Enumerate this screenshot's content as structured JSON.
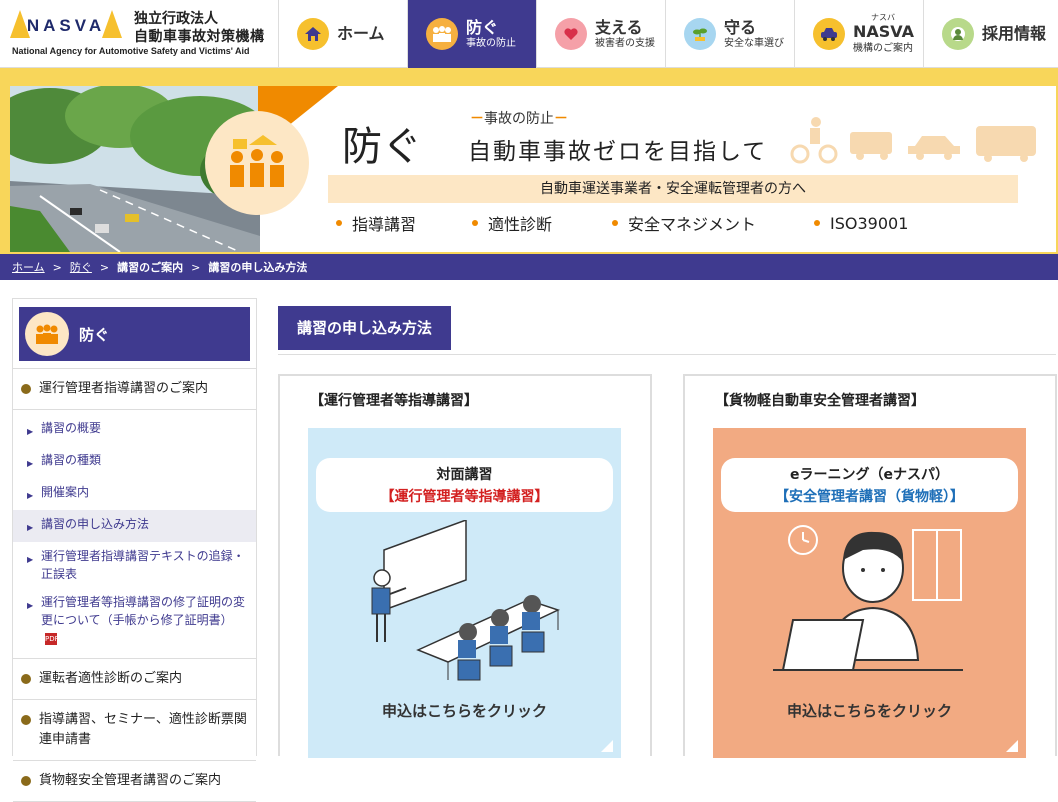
{
  "header": {
    "logo_mark": "NASVA",
    "org_line1": "独立行政法人",
    "org_line2": "自動車事故対策機構",
    "org_en": "National Agency for Automotive Safety and Victims' Aid"
  },
  "gnav": [
    {
      "main": "ホーム",
      "sub": "",
      "icon": "home-icon",
      "color": "#f6c02e"
    },
    {
      "main": "防ぐ",
      "sub": "事故の防止",
      "icon": "people-icon",
      "color": "#f6b040",
      "active": true
    },
    {
      "main": "支える",
      "sub": "被害者の支援",
      "icon": "heart-hand-icon",
      "color": "#f5a0a8"
    },
    {
      "main": "守る",
      "sub": "安全な車選び",
      "icon": "sprout-icon",
      "color": "#a7d6f0"
    },
    {
      "main": "NASVA",
      "ruby": "ナスバ",
      "sub": "機構のご案内",
      "icon": "car-icon",
      "color": "#f6c02e"
    },
    {
      "main": "採用情報",
      "sub": "",
      "icon": "person-icon",
      "color": "#b8d98a"
    }
  ],
  "banner": {
    "title": "防ぐ",
    "kicker": "事故の防止",
    "headline": "自動車事故ゼロを目指して",
    "bar_text": "自動車運送事業者・安全運転管理者の方へ",
    "links": [
      "指導講習",
      "適性診断",
      "安全マネジメント",
      "ISO39001"
    ]
  },
  "breadcrumb": {
    "home": "ホーム",
    "sep": ">",
    "prevent": "防ぐ",
    "courses": "講習のご案内",
    "current": "講習の申し込み方法"
  },
  "sidebar": {
    "head_label": "防ぐ",
    "section1": "運行管理者指導講習のご案内",
    "subs": [
      "講習の概要",
      "講習の種類",
      "開催案内",
      "講習の申し込み方法",
      "運行管理者指導講習テキストの追録・正誤表",
      "運行管理者等指導講習の修了証明の変更について（手帳から修了証明書）"
    ],
    "section2": "運転者適性診断のご案内",
    "section3": "指導講習、セミナー、適性診断票関連申請書",
    "section4": "貨物軽安全管理者講習のご案内",
    "pdf_label": "PDF"
  },
  "main": {
    "page_title": "講習の申し込み方法",
    "cards": [
      {
        "title": "【運行管理者等指導講習】",
        "pill_line1": "対面講習",
        "pill_line2": "【運行管理者等指導講習】",
        "pill_line2_color": "#d32020",
        "cta": "申込はこちらをクリック",
        "panel_color": "#cfeaf8"
      },
      {
        "title": "【貨物軽自動車安全管理者講習】",
        "pill_line1": "eラーニング（eナスパ）",
        "pill_line2": "【安全管理者講習（貨物軽）】",
        "pill_line2_color": "#1e6fb8",
        "cta": "申込はこちらをクリック",
        "panel_color": "#f2aa82"
      }
    ]
  }
}
